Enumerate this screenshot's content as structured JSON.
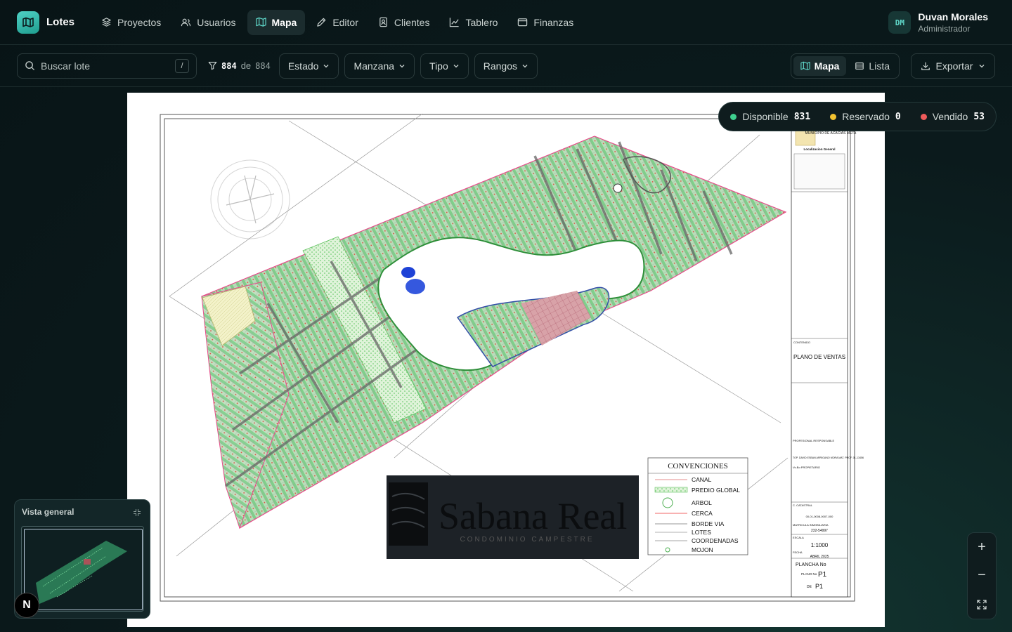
{
  "brand": {
    "name": "Lotes"
  },
  "nav": [
    {
      "label": "Proyectos",
      "icon": "layers-icon",
      "active": false
    },
    {
      "label": "Usuarios",
      "icon": "users-icon",
      "active": false
    },
    {
      "label": "Mapa",
      "icon": "map-icon",
      "active": true
    },
    {
      "label": "Editor",
      "icon": "pen-icon",
      "active": false
    },
    {
      "label": "Clientes",
      "icon": "contact-icon",
      "active": false
    },
    {
      "label": "Tablero",
      "icon": "chart-icon",
      "active": false
    },
    {
      "label": "Finanzas",
      "icon": "wallet-icon",
      "active": false
    }
  ],
  "user": {
    "initials": "DM",
    "name": "Duvan Morales",
    "role": "Administrador"
  },
  "filters": {
    "search_placeholder": "Buscar lote",
    "search_shortcut": "/",
    "count_shown": "884",
    "count_sep": "de",
    "count_total": "884",
    "dropdowns": [
      "Estado",
      "Manzana",
      "Tipo",
      "Rangos"
    ]
  },
  "view": {
    "map_label": "Mapa",
    "list_label": "Lista",
    "active": "map"
  },
  "export_label": "Exportar",
  "status": [
    {
      "label": "Disponible",
      "count": "831",
      "color": "#3ecf8e"
    },
    {
      "label": "Reservado",
      "count": "0",
      "color": "#f2c230"
    },
    {
      "label": "Vendido",
      "count": "53",
      "color": "#ef5b5b"
    }
  ],
  "plan": {
    "municipio": "MUNICIPIO DE ACACIAS META",
    "localizacion": "Localizacion General",
    "contenido": "CONTENIDO",
    "title": "PLANO DE VENTAS",
    "profesional": "PROFESIONAL RESPONSABLE",
    "profesional_name": "TOP. DAVID ESBAN ARRIGANO MORA MAT. PROF. 01-13456",
    "propietario": "Vo.Bo PROPIETARIO",
    "catastral_label": "C. CATASTRAL",
    "catastral": "00-01-0008-0007-000",
    "matricula_label": "MATRICULA INMOBILIARIA",
    "matricula": "232-54997",
    "escala_label": "ESCALA",
    "escala": "1:1000",
    "fecha_label": "FECHA",
    "fecha": "ABRIL 2025",
    "plancha_label": "PLANCHA No",
    "plano_label": "PLANO No",
    "plano": "P1",
    "de_label": "DE",
    "de": "P1",
    "brand_title": "Sabana Real",
    "brand_sub": "CONDOMINIO CAMPESTRE",
    "convenciones_title": "CONVENCIONES",
    "convenciones": [
      "CANAL",
      "PREDIO GLOBAL",
      "ARBOL",
      "CERCA",
      "BORDE VIA",
      "LOTES",
      "COORDENADAS",
      "MOJON"
    ]
  },
  "overview": {
    "title": "Vista general"
  },
  "badge": "N",
  "zoom": {
    "in": "+",
    "out": "−"
  }
}
